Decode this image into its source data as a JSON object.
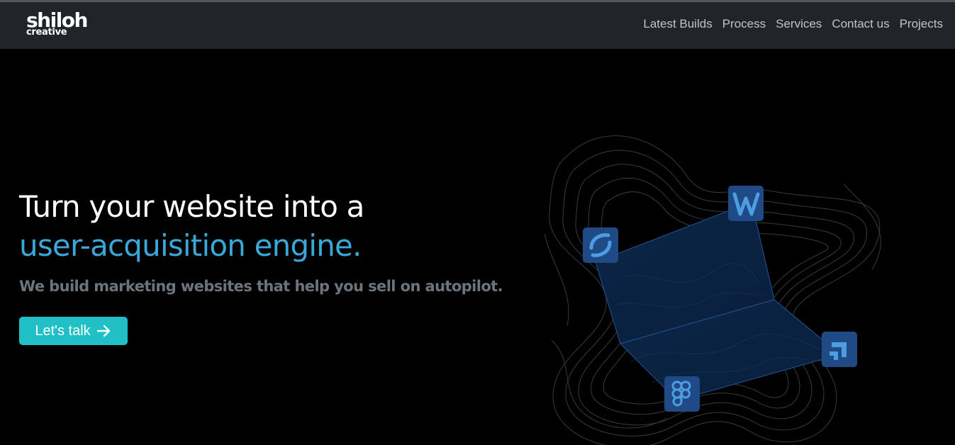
{
  "brand": {
    "name": "shiloh",
    "tagline": "creative"
  },
  "nav": {
    "links": [
      "Latest Builds",
      "Process",
      "Services",
      "Contact us",
      "Projects"
    ]
  },
  "hero": {
    "title_line1": "Turn your website into a",
    "title_line2": "user-acquisition engine.",
    "subtitle": "We build marketing websites that help you sell on autopilot.",
    "cta_label": "Let's talk"
  },
  "illustration": {
    "icons": [
      "refresh-swirl-icon",
      "webflow-icon",
      "figma-icon",
      "jira-arrow-icon"
    ]
  },
  "colors": {
    "navbar_bg": "#212529",
    "accent_blue": "#3ba7d8",
    "cta_bg": "#20c0c6",
    "muted_text": "#6c757d",
    "icon_tile": "#1f4a86"
  }
}
